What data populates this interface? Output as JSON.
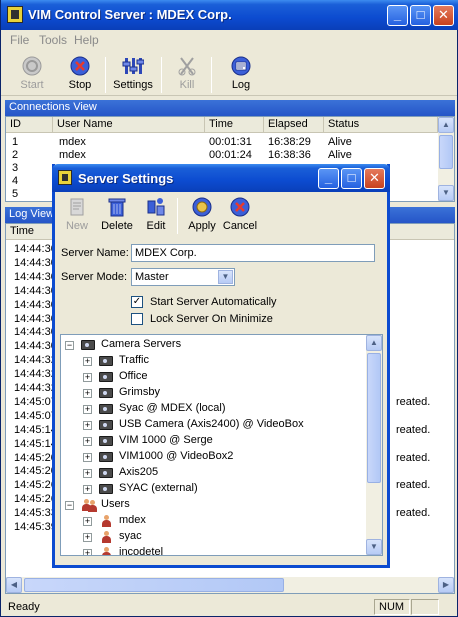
{
  "window": {
    "title": "VIM Control Server : MDEX Corp.",
    "minimize": "_",
    "maximize": "□",
    "close": "✕"
  },
  "menu": [
    "File",
    "Tools",
    "Help"
  ],
  "toolbar": {
    "start": "Start",
    "stop": "Stop",
    "settings": "Settings",
    "kill": "Kill",
    "log": "Log"
  },
  "connections": {
    "title": "Connections View",
    "headers": [
      "ID",
      "User Name",
      "Time",
      "Elapsed",
      "Status"
    ],
    "rows": [
      {
        "id": "1",
        "user": "mdex",
        "time": "00:01:31",
        "elapsed": "16:38:29",
        "status": "Alive"
      },
      {
        "id": "2",
        "user": "mdex",
        "time": "00:01:24",
        "elapsed": "16:38:36",
        "status": "Alive"
      },
      {
        "id": "3",
        "user": "",
        "time": "",
        "elapsed": "",
        "status": ""
      },
      {
        "id": "4",
        "user": "",
        "time": "",
        "elapsed": "",
        "status": ""
      },
      {
        "id": "5",
        "user": "",
        "time": "",
        "elapsed": "",
        "status": ""
      }
    ]
  },
  "log": {
    "title": "Log View",
    "header": "Time",
    "times": [
      "14:44:30",
      "14:44:30",
      "14:44:30",
      "14:44:30",
      "14:44:30",
      "14:44:30",
      "14:44:30",
      "14:44:30",
      "14:44:32",
      "14:44:32",
      "14:44:32",
      "14:45:07",
      "14:45:07",
      "14:45:14",
      "14:45:14",
      "14:45:20",
      "14:45:20",
      "14:45:26",
      "14:45:26",
      "14:45:33",
      "14:45:39"
    ],
    "right_text": {
      "11": "reated.",
      "13": "reated.",
      "15": "reated.",
      "17": "reated.",
      "19": "reated."
    }
  },
  "status": {
    "text": "Ready",
    "num": "NUM"
  },
  "dialog": {
    "title": "Server Settings",
    "toolbar": {
      "new": "New",
      "delete": "Delete",
      "edit": "Edit",
      "apply": "Apply",
      "cancel": "Cancel"
    },
    "server_name_label": "Server Name:",
    "server_name_value": "MDEX Corp.",
    "server_mode_label": "Server Mode:",
    "server_mode_value": "Master",
    "start_auto_label": "Start Server Automatically",
    "start_auto_checked": true,
    "lock_min_label": "Lock Server On Minimize",
    "lock_min_checked": false,
    "tree": {
      "camera_servers": "Camera Servers",
      "cameras": [
        "Traffic",
        "Office",
        "Grimsby",
        "Syac @ MDEX (local)",
        "USB Camera (Axis2400) @ VideoBox",
        "VIM 1000 @ Serge",
        "VIM1000 @ VideoBox2",
        "Axis205",
        "SYAC (external)"
      ],
      "users": "Users",
      "user_list": [
        "mdex",
        "syac",
        "incodetel"
      ]
    }
  }
}
